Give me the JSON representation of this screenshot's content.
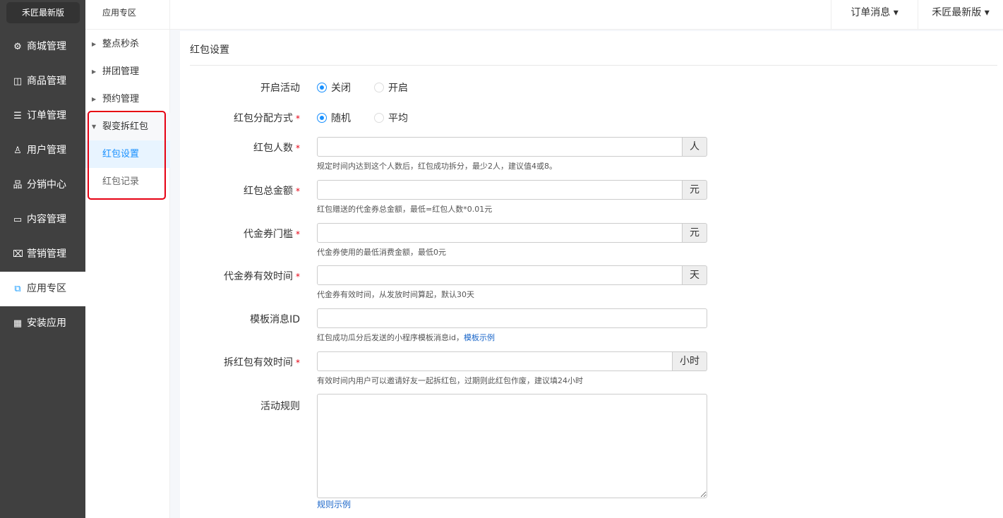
{
  "sidebar": {
    "logo": "禾匠最新版",
    "items": [
      {
        "label": "商城管理",
        "icon": "gear-icon",
        "glyph": "⚙"
      },
      {
        "label": "商品管理",
        "icon": "bag-icon",
        "glyph": "◫"
      },
      {
        "label": "订单管理",
        "icon": "list-icon",
        "glyph": "☰"
      },
      {
        "label": "用户管理",
        "icon": "user-icon",
        "glyph": "♙"
      },
      {
        "label": "分销中心",
        "icon": "org-icon",
        "glyph": "品"
      },
      {
        "label": "内容管理",
        "icon": "content-icon",
        "glyph": "▭"
      },
      {
        "label": "营销管理",
        "icon": "ticket-icon",
        "glyph": "⌧"
      },
      {
        "label": "应用专区",
        "icon": "puzzle-icon",
        "glyph": "⧉",
        "active": true
      },
      {
        "label": "安装应用",
        "icon": "apps-icon",
        "glyph": "▦"
      }
    ]
  },
  "submenu": {
    "title": "应用专区",
    "items": [
      {
        "label": "整点秒杀"
      },
      {
        "label": "拼团管理"
      },
      {
        "label": "预约管理"
      },
      {
        "label": "裂变拆红包",
        "expanded": true
      }
    ],
    "children": [
      {
        "label": "红包设置",
        "selected": true
      },
      {
        "label": "红包记录"
      }
    ]
  },
  "topbar": {
    "messages": "订单消息 ▾",
    "account": "禾匠最新版 ▾"
  },
  "panel": {
    "title": "红包设置",
    "activity": {
      "label": "开启活动",
      "options": [
        "关闭",
        "开启"
      ],
      "selected": "关闭"
    },
    "distribution": {
      "label": "红包分配方式",
      "options": [
        "随机",
        "平均"
      ],
      "selected": "随机"
    },
    "fields": [
      {
        "label": "红包人数",
        "unit": "人",
        "value": "",
        "help": "规定时间内达到这个人数后，红包成功拆分，最少2人，建议值4或8。"
      },
      {
        "label": "红包总金额",
        "unit": "元",
        "value": "",
        "help": "红包赠送的代金券总金额，最低=红包人数*0.01元"
      },
      {
        "label": "代金券门槛",
        "unit": "元",
        "value": "",
        "help": "代金券使用的最低消费金额，最低0元"
      },
      {
        "label": "代金券有效时间",
        "unit": "天",
        "value": "",
        "help": "代金券有效时间，从发放时间算起，默认30天"
      },
      {
        "label": "模板消息ID",
        "value": "",
        "help": "红包成功瓜分后发送的小程序模板消息id，",
        "help_link": "模板示例"
      },
      {
        "label": "拆红包有效时间",
        "unit": "小时",
        "value": "",
        "help": "有效时间内用户可以邀请好友一起拆红包，过期则此红包作废，建议填24小时"
      }
    ],
    "rules": {
      "label": "活动规则",
      "value": "",
      "link": "规则示例"
    }
  },
  "colors": {
    "accent": "#1890ff",
    "sidebar": "#404040",
    "highlight": "#e60012"
  }
}
